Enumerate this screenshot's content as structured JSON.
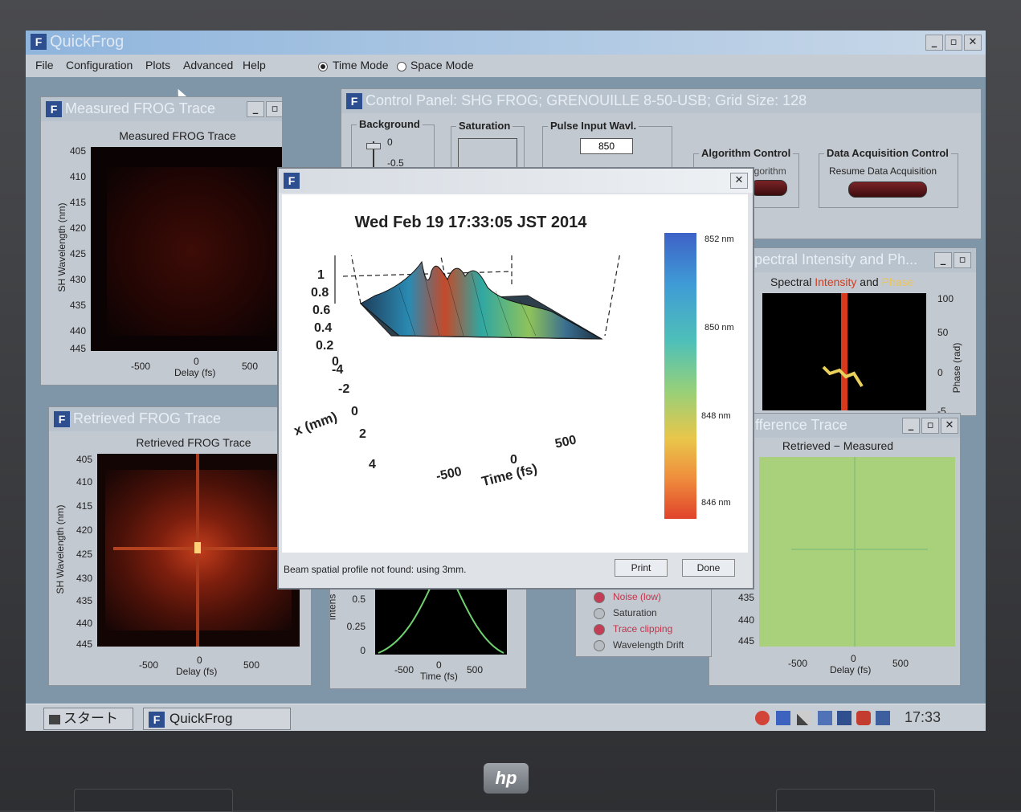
{
  "app": {
    "title": "QuickFrog"
  },
  "menu": [
    "File",
    "Configuration",
    "Plots",
    "Advanced",
    "Help"
  ],
  "modes": {
    "time": "Time Mode",
    "space": "Space Mode",
    "selected": "time"
  },
  "measured": {
    "window_title": "Measured FROG Trace",
    "plot_title": "Measured FROG Trace",
    "ylabel": "SH Wavelength (nm)",
    "xlabel": "Delay (fs)",
    "yticks": [
      "405",
      "410",
      "415",
      "420",
      "425",
      "430",
      "435",
      "440",
      "445"
    ],
    "xticks": [
      "-500",
      "0",
      "500"
    ]
  },
  "retrieved": {
    "window_title": "Retrieved FROG Trace",
    "plot_title": "Retrieved FROG Trace",
    "ylabel": "SH Wavelength (nm)",
    "xlabel": "Delay (fs)",
    "yticks": [
      "405",
      "410",
      "415",
      "420",
      "425",
      "430",
      "435",
      "440",
      "445"
    ],
    "xticks": [
      "-500",
      "0",
      "500"
    ]
  },
  "control": {
    "window_title": "Control Panel: SHG FROG; GRENOUILLE 8-50-USB; Grid Size: 128",
    "background": {
      "label": "Background",
      "ticks": [
        "0",
        "-0.5"
      ]
    },
    "saturation": {
      "label": "Saturation"
    },
    "pulse": {
      "label": "Pulse Input Wavl.",
      "value": "850"
    },
    "algorithm": {
      "label": "Algorithm Control",
      "action": "Algorithm"
    },
    "daq": {
      "label": "Data Acquisition Control",
      "action": "Resume Data Acquisition"
    }
  },
  "spectral": {
    "window_title": "Spectral Intensity and Ph...",
    "title_a": "Spectral",
    "title_b": "Intensity",
    "title_c": "and",
    "title_d": "Phase",
    "right_label": "Phase (rad)",
    "right_ticks": [
      "100",
      "50",
      "0",
      "-5"
    ]
  },
  "difference": {
    "window_title": "Difference Trace",
    "plot_title": "Retrieved − Measured",
    "yticks": [
      "435",
      "440",
      "445"
    ],
    "xticks": [
      "-500",
      "0",
      "500"
    ],
    "xlabel": "Delay (fs)"
  },
  "temporal": {
    "ylabel": "Intens",
    "yticks": [
      "0.5",
      "0.25",
      "0"
    ],
    "xticks": [
      "-500",
      "0",
      "500"
    ],
    "xlabel": "Time (fs)"
  },
  "warnings": [
    {
      "label": "Noise (low)",
      "active": true
    },
    {
      "label": "Saturation",
      "active": false
    },
    {
      "label": "Trace clipping",
      "active": true
    },
    {
      "label": "Wavelength Drift",
      "active": false
    }
  ],
  "dialog": {
    "timestamp": "Wed Feb 19 17:33:05 JST 2014",
    "status": "Beam spatial profile not found: using 3mm.",
    "print": "Print",
    "done": "Done",
    "colorbar_labels": [
      "852 nm",
      "850 nm",
      "848 nm",
      "846 nm"
    ],
    "z_ticks": [
      "1",
      "0.8",
      "0.6",
      "0.4",
      "0.2",
      "0"
    ],
    "x_ticks": [
      "-4",
      "-2",
      "0",
      "2",
      "4"
    ],
    "t_ticks": [
      "-500",
      "0",
      "500"
    ],
    "x_label": "x (mm)",
    "t_label": "Time (fs)"
  },
  "taskbar": {
    "start": "スタート",
    "app": "QuickFrog",
    "clock": "17:33"
  },
  "brand": "hp",
  "colors": {
    "accent": "#2d4f8f",
    "screen": "#7f95a8",
    "plot_bg": "#000000",
    "diff_bg": "#a9d07a"
  }
}
